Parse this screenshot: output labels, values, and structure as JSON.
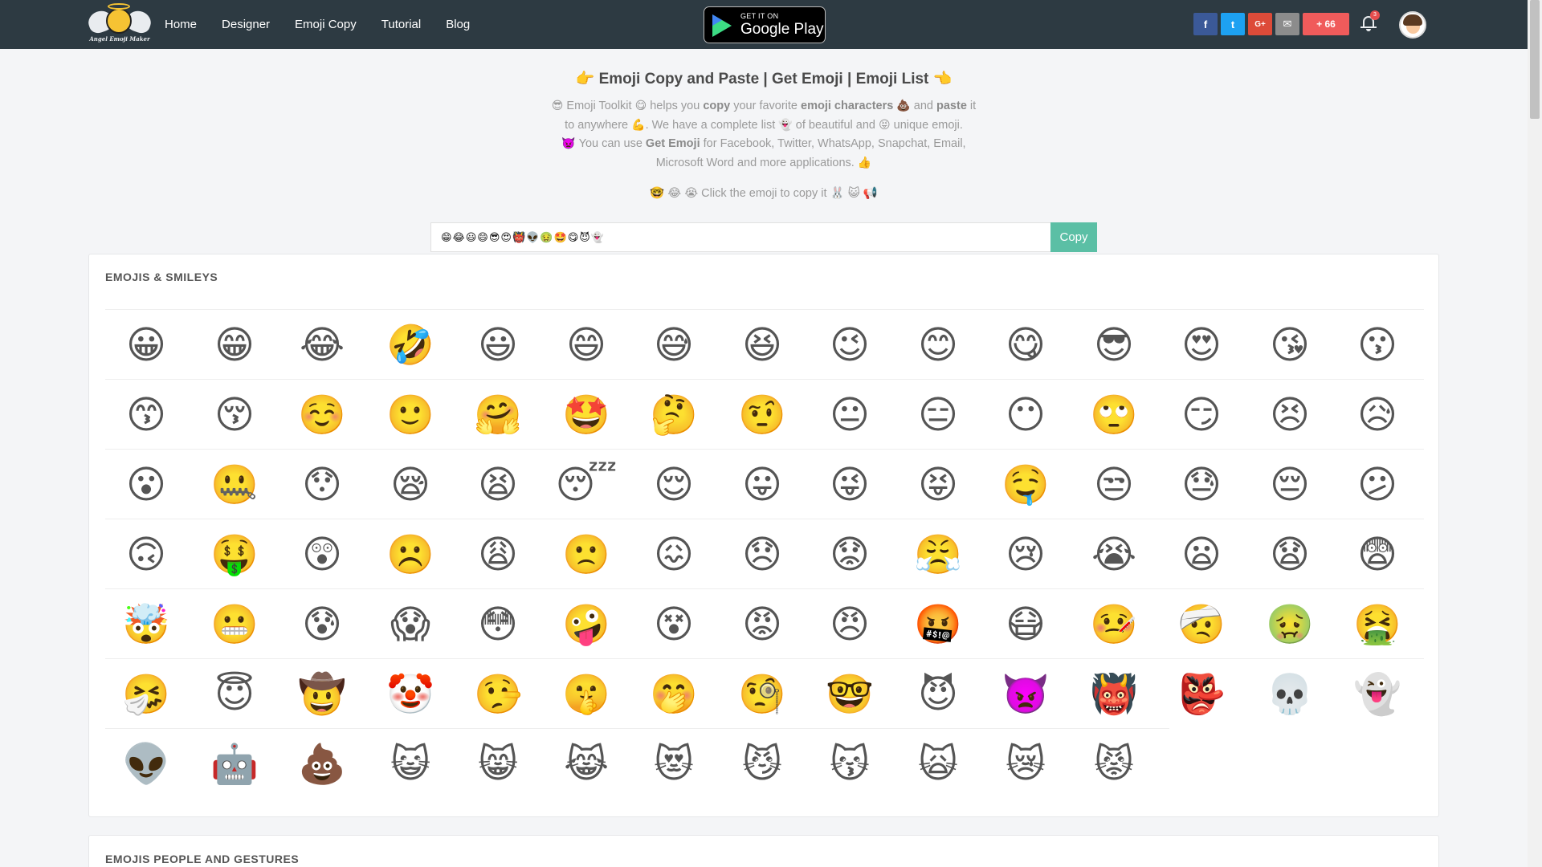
{
  "nav": {
    "logo_text": "Angel Emoji Maker",
    "links": [
      "Home",
      "Designer",
      "Emoji Copy",
      "Tutorial",
      "Blog"
    ],
    "store_badge": {
      "small": "GET IT ON",
      "big": "Google Play"
    },
    "share": [
      {
        "icon": "f",
        "color": "#3b5998"
      },
      {
        "icon": "t",
        "color": "#1da1f2"
      },
      {
        "icon": "G+",
        "color": "#dd4b39"
      },
      {
        "icon": "✉",
        "color": "#8c8c8c"
      }
    ],
    "share_count": {
      "label": "+ 66",
      "color": "#f05b5b"
    },
    "notification_count": "3"
  },
  "header": {
    "title_emoji_left": "👉",
    "title": "Emoji Copy and Paste | Get Emoji | Emoji List",
    "title_emoji_right": "👈",
    "desc": {
      "e1": "😎",
      "t1": " Emoji Toolkit ",
      "e2": "😋",
      "t2": " helps you ",
      "b1": "copy",
      "t3": " your favorite ",
      "b2": "emoji characters",
      "e3": "💩",
      "t4": " and ",
      "b3": "paste",
      "t5": " it to anywhere ",
      "e4": "💪",
      "t6": ". We have a complete list ",
      "e5": "👻",
      "t7": " of beautiful and ",
      "e6": "😝",
      "t8": " unique emoji.",
      "e7": "👿",
      "t9": " You can use ",
      "b4": "Get Emoji",
      "t10": " for Facebook, Twitter, WhatsApp, Snapchat, Email, Microsoft Word and more applications. ",
      "e8": "👍"
    },
    "click_line": {
      "prefix": "🤓 😂 😭",
      "text": " Click the emoji to copy it ",
      "suffix": "🐰 😺 📢"
    }
  },
  "copy_box": {
    "value": "😁😂😃😄😎😍👹👽🤢🤩😋😈👻",
    "button_label": "Copy"
  },
  "sections": [
    {
      "title": "EMOJIS & SMILEYS",
      "rows": [
        [
          "😀",
          "😁",
          "😂",
          "🤣",
          "😃",
          "😄",
          "😅",
          "😆",
          "😉",
          "😊",
          "😋",
          "😎",
          "😍",
          "😘",
          "😗"
        ],
        [
          "😙",
          "😚",
          "☺️",
          "🙂",
          "🤗",
          "🤩",
          "🤔",
          "🤨",
          "😐",
          "😑",
          "😶",
          "🙄",
          "😏",
          "😣",
          "😥"
        ],
        [
          "😮",
          "🤐",
          "😯",
          "😪",
          "😫",
          "😴",
          "😌",
          "😛",
          "😜",
          "😝",
          "🤤",
          "😒",
          "😓",
          "😔",
          "😕"
        ],
        [
          "🙃",
          "🤑",
          "😲",
          "☹️",
          "😩",
          "🙁",
          "😖",
          "😞",
          "😟",
          "😤",
          "😢",
          "😭",
          "😦",
          "😧",
          "😨"
        ],
        [
          "🤯",
          "😬",
          "😰",
          "😱",
          "😳",
          "🤪",
          "😵",
          "😡",
          "😠",
          "🤬",
          "😷",
          "🤒",
          "🤕",
          "🤢",
          "🤮"
        ],
        [
          "🤧",
          "😇",
          "🤠",
          "🤡",
          "🤥",
          "🤫",
          "🤭",
          "🧐",
          "🤓",
          "😈",
          "👿",
          "👹",
          "👺",
          "💀",
          "👻"
        ],
        [
          "👽",
          "🤖",
          "💩",
          "😺",
          "😸",
          "😹",
          "😻",
          "😼",
          "😽",
          "🙀",
          "😿",
          "😾"
        ]
      ]
    },
    {
      "title": "EMOJIS PEOPLE AND GESTURES"
    }
  ]
}
